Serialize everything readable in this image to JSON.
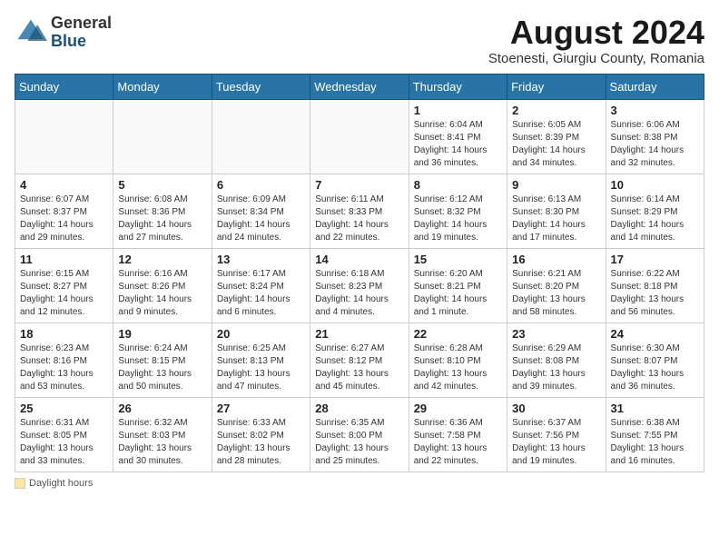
{
  "logo": {
    "general": "General",
    "blue": "Blue"
  },
  "title": {
    "month_year": "August 2024",
    "location": "Stoenesti, Giurgiu County, Romania"
  },
  "calendar": {
    "headers": [
      "Sunday",
      "Monday",
      "Tuesday",
      "Wednesday",
      "Thursday",
      "Friday",
      "Saturday"
    ],
    "weeks": [
      [
        {
          "day": "",
          "info": ""
        },
        {
          "day": "",
          "info": ""
        },
        {
          "day": "",
          "info": ""
        },
        {
          "day": "",
          "info": ""
        },
        {
          "day": "1",
          "info": "Sunrise: 6:04 AM\nSunset: 8:41 PM\nDaylight: 14 hours and 36 minutes."
        },
        {
          "day": "2",
          "info": "Sunrise: 6:05 AM\nSunset: 8:39 PM\nDaylight: 14 hours and 34 minutes."
        },
        {
          "day": "3",
          "info": "Sunrise: 6:06 AM\nSunset: 8:38 PM\nDaylight: 14 hours and 32 minutes."
        }
      ],
      [
        {
          "day": "4",
          "info": "Sunrise: 6:07 AM\nSunset: 8:37 PM\nDaylight: 14 hours and 29 minutes."
        },
        {
          "day": "5",
          "info": "Sunrise: 6:08 AM\nSunset: 8:36 PM\nDaylight: 14 hours and 27 minutes."
        },
        {
          "day": "6",
          "info": "Sunrise: 6:09 AM\nSunset: 8:34 PM\nDaylight: 14 hours and 24 minutes."
        },
        {
          "day": "7",
          "info": "Sunrise: 6:11 AM\nSunset: 8:33 PM\nDaylight: 14 hours and 22 minutes."
        },
        {
          "day": "8",
          "info": "Sunrise: 6:12 AM\nSunset: 8:32 PM\nDaylight: 14 hours and 19 minutes."
        },
        {
          "day": "9",
          "info": "Sunrise: 6:13 AM\nSunset: 8:30 PM\nDaylight: 14 hours and 17 minutes."
        },
        {
          "day": "10",
          "info": "Sunrise: 6:14 AM\nSunset: 8:29 PM\nDaylight: 14 hours and 14 minutes."
        }
      ],
      [
        {
          "day": "11",
          "info": "Sunrise: 6:15 AM\nSunset: 8:27 PM\nDaylight: 14 hours and 12 minutes."
        },
        {
          "day": "12",
          "info": "Sunrise: 6:16 AM\nSunset: 8:26 PM\nDaylight: 14 hours and 9 minutes."
        },
        {
          "day": "13",
          "info": "Sunrise: 6:17 AM\nSunset: 8:24 PM\nDaylight: 14 hours and 6 minutes."
        },
        {
          "day": "14",
          "info": "Sunrise: 6:18 AM\nSunset: 8:23 PM\nDaylight: 14 hours and 4 minutes."
        },
        {
          "day": "15",
          "info": "Sunrise: 6:20 AM\nSunset: 8:21 PM\nDaylight: 14 hours and 1 minute."
        },
        {
          "day": "16",
          "info": "Sunrise: 6:21 AM\nSunset: 8:20 PM\nDaylight: 13 hours and 58 minutes."
        },
        {
          "day": "17",
          "info": "Sunrise: 6:22 AM\nSunset: 8:18 PM\nDaylight: 13 hours and 56 minutes."
        }
      ],
      [
        {
          "day": "18",
          "info": "Sunrise: 6:23 AM\nSunset: 8:16 PM\nDaylight: 13 hours and 53 minutes."
        },
        {
          "day": "19",
          "info": "Sunrise: 6:24 AM\nSunset: 8:15 PM\nDaylight: 13 hours and 50 minutes."
        },
        {
          "day": "20",
          "info": "Sunrise: 6:25 AM\nSunset: 8:13 PM\nDaylight: 13 hours and 47 minutes."
        },
        {
          "day": "21",
          "info": "Sunrise: 6:27 AM\nSunset: 8:12 PM\nDaylight: 13 hours and 45 minutes."
        },
        {
          "day": "22",
          "info": "Sunrise: 6:28 AM\nSunset: 8:10 PM\nDaylight: 13 hours and 42 minutes."
        },
        {
          "day": "23",
          "info": "Sunrise: 6:29 AM\nSunset: 8:08 PM\nDaylight: 13 hours and 39 minutes."
        },
        {
          "day": "24",
          "info": "Sunrise: 6:30 AM\nSunset: 8:07 PM\nDaylight: 13 hours and 36 minutes."
        }
      ],
      [
        {
          "day": "25",
          "info": "Sunrise: 6:31 AM\nSunset: 8:05 PM\nDaylight: 13 hours and 33 minutes."
        },
        {
          "day": "26",
          "info": "Sunrise: 6:32 AM\nSunset: 8:03 PM\nDaylight: 13 hours and 30 minutes."
        },
        {
          "day": "27",
          "info": "Sunrise: 6:33 AM\nSunset: 8:02 PM\nDaylight: 13 hours and 28 minutes."
        },
        {
          "day": "28",
          "info": "Sunrise: 6:35 AM\nSunset: 8:00 PM\nDaylight: 13 hours and 25 minutes."
        },
        {
          "day": "29",
          "info": "Sunrise: 6:36 AM\nSunset: 7:58 PM\nDaylight: 13 hours and 22 minutes."
        },
        {
          "day": "30",
          "info": "Sunrise: 6:37 AM\nSunset: 7:56 PM\nDaylight: 13 hours and 19 minutes."
        },
        {
          "day": "31",
          "info": "Sunrise: 6:38 AM\nSunset: 7:55 PM\nDaylight: 13 hours and 16 minutes."
        }
      ]
    ]
  },
  "footer": {
    "daylight_label": "Daylight hours"
  }
}
